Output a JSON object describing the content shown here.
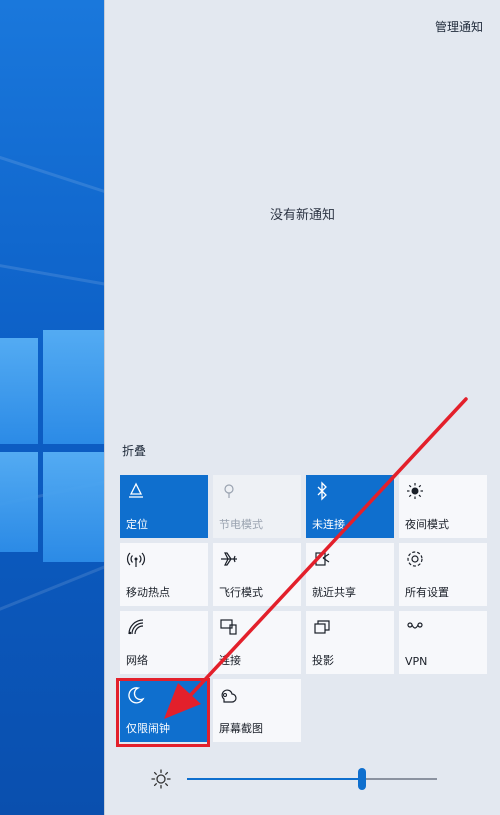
{
  "action_center": {
    "manage_notifications": "管理通知",
    "empty_message": "没有新通知",
    "collapse_label": "折叠"
  },
  "quick_actions": [
    {
      "label": "定位",
      "icon": "location-icon",
      "state": "on"
    },
    {
      "label": "节电模式",
      "icon": "battery-saver-icon",
      "state": "disabled"
    },
    {
      "label": "未连接",
      "icon": "bluetooth-icon",
      "state": "on"
    },
    {
      "label": "夜间模式",
      "icon": "night-light-icon",
      "state": "off"
    },
    {
      "label": "移动热点",
      "icon": "hotspot-icon",
      "state": "off"
    },
    {
      "label": "飞行模式",
      "icon": "airplane-icon",
      "state": "off"
    },
    {
      "label": "就近共享",
      "icon": "nearby-share-icon",
      "state": "off"
    },
    {
      "label": "所有设置",
      "icon": "gear-icon",
      "state": "off"
    },
    {
      "label": "网络",
      "icon": "network-icon",
      "state": "off"
    },
    {
      "label": "连接",
      "icon": "connect-icon",
      "state": "off"
    },
    {
      "label": "投影",
      "icon": "project-icon",
      "state": "off"
    },
    {
      "label": "VPN",
      "icon": "vpn-icon",
      "state": "off"
    },
    {
      "label": "仅限闹钟",
      "icon": "moon-icon",
      "state": "on"
    },
    {
      "label": "屏幕截图",
      "icon": "snip-icon",
      "state": "off"
    }
  ],
  "brightness": {
    "icon": "sun-icon",
    "level": 0.7
  },
  "colors": {
    "accent": "#0f6fce",
    "panel_bg": "#e3e8f0",
    "annotation": "#e3202b"
  }
}
